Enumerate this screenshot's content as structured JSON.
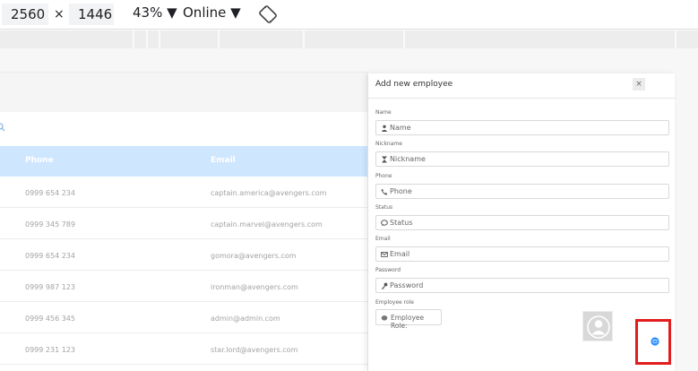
{
  "toolbar": {
    "width_value": "2560",
    "separator": "×",
    "height_value": "1446",
    "zoom": "43% ▼",
    "network": "Online ▼"
  },
  "table": {
    "headers": [
      "Phone",
      "Email"
    ],
    "rows": [
      {
        "phone": "0999 654 234",
        "email": "captain.america@avengers.com"
      },
      {
        "phone": "0999 345 789",
        "email": "captain.marvel@avengers.com"
      },
      {
        "phone": "0999 654 234",
        "email": "gomora@avengers.com"
      },
      {
        "phone": "0999 987 123",
        "email": "ironman@avengers.com"
      },
      {
        "phone": "0999 456 345",
        "email": "admin@admin.com"
      },
      {
        "phone": "0999 231 123",
        "email": "star.lord@avengers.com"
      }
    ]
  },
  "modal": {
    "title": "Add new employee",
    "close": "×",
    "fields": {
      "name": {
        "label": "Name",
        "placeholder": "Name"
      },
      "nickname": {
        "label": "Nickname",
        "placeholder": "Nickname"
      },
      "phone": {
        "label": "Phone",
        "placeholder": "Phone"
      },
      "status": {
        "label": "Status",
        "placeholder": "Status"
      },
      "email": {
        "label": "Email",
        "placeholder": "Email"
      },
      "password": {
        "label": "Password",
        "placeholder": "Password"
      }
    },
    "role": {
      "label": "Employee role",
      "placeholder": "Employee Role:"
    }
  },
  "icons": {
    "name": "user-icon",
    "nickname": "hourglass-icon",
    "phone": "phone-icon",
    "status": "chat-icon",
    "email": "envelope-icon",
    "password": "key-icon",
    "rotate": "rotate-icon",
    "fab": "chat-bubble-icon"
  },
  "colors": {
    "table_header": "#cfe6ff",
    "highlight": "#e11d1d",
    "fab": "#2f8fff"
  }
}
